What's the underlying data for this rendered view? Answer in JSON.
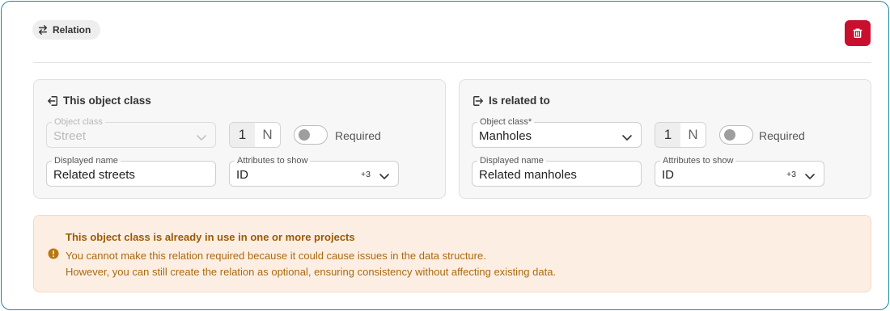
{
  "header": {
    "chip_label": "Relation",
    "chip_icon": "swap-arrows-icon",
    "delete_icon": "trash-icon",
    "delete_color": "#c8102e"
  },
  "left_panel": {
    "title": "This object class",
    "title_icon": "arrow-left-into-box-icon",
    "object_class": {
      "label": "Object class",
      "value": "Street",
      "disabled": true
    },
    "cardinality": {
      "one": "1",
      "many": "N",
      "selected": "1"
    },
    "required": {
      "label": "Required",
      "checked": false
    },
    "displayed_name": {
      "label": "Displayed name",
      "value": "Related streets"
    },
    "attributes": {
      "label": "Attributes to show",
      "value": "ID",
      "more": "+3"
    }
  },
  "right_panel": {
    "title": "Is related to",
    "title_icon": "arrow-right-into-box-icon",
    "object_class": {
      "label": "Object class*",
      "value": "Manholes",
      "disabled": false
    },
    "cardinality": {
      "one": "1",
      "many": "N",
      "selected": "1"
    },
    "required": {
      "label": "Required",
      "checked": false
    },
    "displayed_name": {
      "label": "Displayed name",
      "value": "Related manholes"
    },
    "attributes": {
      "label": "Attributes to show",
      "value": "ID",
      "more": "+3"
    }
  },
  "warning": {
    "icon": "warning-circle-icon",
    "title": "This object class is already in use in one or more projects",
    "line1": "You cannot make this relation required because it could cause issues in the data structure.",
    "line2": "However, you can still create the relation as optional, ensuring consistency without affecting existing data.",
    "accent": "#9a5a00"
  },
  "colors": {
    "frame_border": "#1a8a9e",
    "warning_bg": "#fdeee3"
  }
}
